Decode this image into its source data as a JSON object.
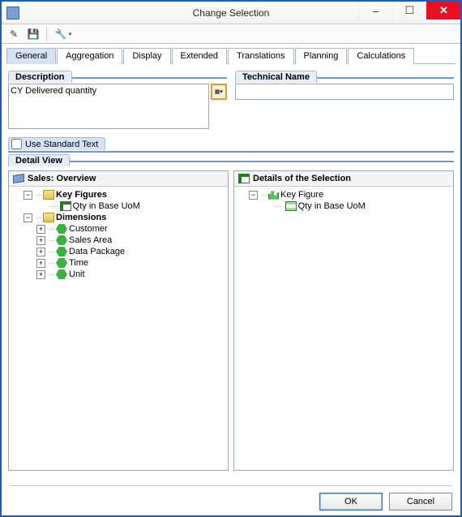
{
  "window": {
    "title": "Change Selection"
  },
  "tabs": [
    "General",
    "Aggregation",
    "Display",
    "Extended",
    "Translations",
    "Planning",
    "Calculations"
  ],
  "active_tab_index": 0,
  "description": {
    "label": "Description",
    "value": "CY Delivered quantity"
  },
  "technical_name": {
    "label": "Technical Name",
    "value": ""
  },
  "use_standard_text": {
    "label": "Use Standard Text",
    "checked": false
  },
  "detail_view": {
    "label": "Detail View"
  },
  "left_pane": {
    "header": "Sales: Overview",
    "tree": {
      "key_figures": {
        "label": "Key Figures",
        "items": [
          "Qty in Base UoM"
        ]
      },
      "dimensions": {
        "label": "Dimensions",
        "items": [
          "Customer",
          "Sales Area",
          "Data Package",
          "Time",
          "Unit"
        ]
      }
    }
  },
  "right_pane": {
    "header": "Details of the Selection",
    "tree": {
      "key_figure": {
        "label": "Key Figure",
        "items": [
          "Qty in Base UoM"
        ]
      }
    }
  },
  "footer": {
    "ok": "OK",
    "cancel": "Cancel"
  }
}
